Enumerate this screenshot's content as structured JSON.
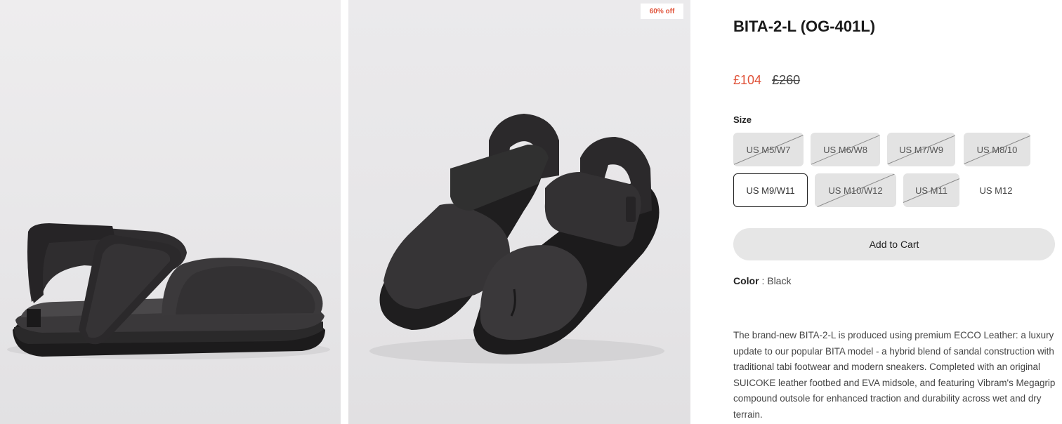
{
  "product": {
    "title": "BITA-2-L (OG-401L)",
    "discount_badge": "60% off",
    "price_sale": "£104",
    "price_original": "£260",
    "size_label": "Size",
    "sizes": [
      {
        "label": "US M5/W7",
        "state": "unavailable"
      },
      {
        "label": "US M6/W8",
        "state": "unavailable"
      },
      {
        "label": "US M7/W9",
        "state": "unavailable"
      },
      {
        "label": "US M8/10",
        "state": "unavailable"
      },
      {
        "label": "US M9/W11",
        "state": "selected"
      },
      {
        "label": "US M10/W12",
        "state": "unavailable"
      },
      {
        "label": "US M11",
        "state": "unavailable"
      },
      {
        "label": "US M12",
        "state": "available"
      }
    ],
    "add_to_cart_label": "Add to Cart",
    "color_label": "Color",
    "color_separator": " : ",
    "color_value": "Black",
    "description": "The brand-new BITA-2-L is produced using premium ECCO Leather: a luxury update to our popular BITA model - a hybrid blend of sandal construction with traditional tabi footwear and modern sneakers. Completed with an original SUICOKE leather footbed and EVA midsole, and featuring Vibram's Megagrip compound outsole for enhanced traction and durability across wet and dry terrain."
  },
  "colors": {
    "sale_price": "#e0533a",
    "size_button_bg": "#e3e3e3",
    "add_to_cart_bg": "#e6e6e6",
    "image_bg": "#e9e8e9",
    "sandal": "#2d2b2d"
  }
}
